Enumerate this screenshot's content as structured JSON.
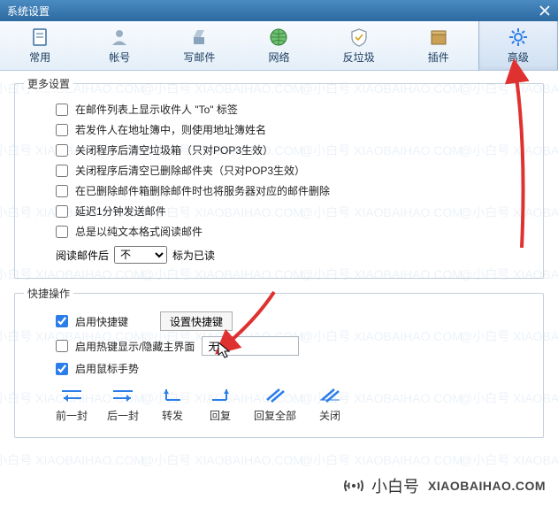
{
  "window": {
    "title": "系统设置"
  },
  "tabs": [
    {
      "label": "常用",
      "icon": "page"
    },
    {
      "label": "帐号",
      "icon": "user"
    },
    {
      "label": "写邮件",
      "icon": "compose"
    },
    {
      "label": "网络",
      "icon": "globe"
    },
    {
      "label": "反垃圾",
      "icon": "shield"
    },
    {
      "label": "插件",
      "icon": "box"
    },
    {
      "label": "高级",
      "icon": "gear"
    }
  ],
  "more": {
    "legend": "更多设置",
    "items": [
      "在邮件列表上显示收件人 \"To\" 标签",
      "若发件人在地址簿中，则使用地址簿姓名",
      "关闭程序后清空垃圾箱（只对POP3生效）",
      "关闭程序后清空已删除邮件夹（只对POP3生效）",
      "在已删除邮件箱删除邮件时也将服务器对应的邮件删除",
      "延迟1分钟发送邮件",
      "总是以纯文本格式阅读邮件"
    ],
    "read_prefix": "阅读邮件后",
    "read_select": "不",
    "read_suffix": "标为已读"
  },
  "shortcut": {
    "legend": "快捷操作",
    "enable_hotkey": "启用快捷键",
    "set_hotkey_btn": "设置快捷键",
    "enable_showhide": "启用热键显示/隐藏主界面",
    "showhide_value": "无",
    "enable_gesture": "启用鼠标手势",
    "gestures": [
      "前一封",
      "后一封",
      "转发",
      "回复",
      "回复全部",
      "关闭"
    ]
  },
  "badge": {
    "text1": "小白号",
    "text2": "XIAOBAIHAO.COM"
  }
}
